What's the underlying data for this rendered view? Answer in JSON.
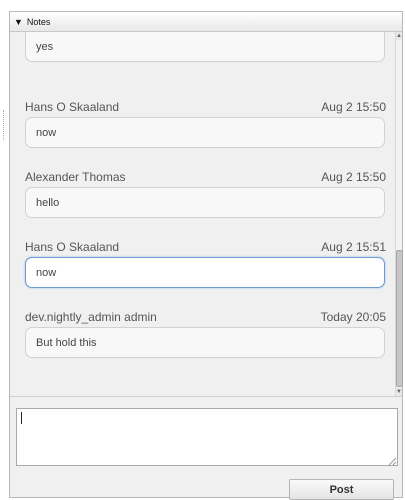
{
  "panel": {
    "title": "Notes",
    "collapse_icon": "triangle-down-icon"
  },
  "notes": [
    {
      "author": "",
      "time": "",
      "text": "yes"
    },
    {
      "author": "Hans O Skaaland",
      "time": "Aug 2 15:50",
      "text": "now"
    },
    {
      "author": "Alexander Thomas",
      "time": "Aug 2 15:50",
      "text": "hello"
    },
    {
      "author": "Hans O Skaaland",
      "time": "Aug 2 15:51",
      "text": "now"
    },
    {
      "author": "dev.nightly_admin admin",
      "time": "Today 20:05",
      "text": "But hold this"
    }
  ],
  "compose": {
    "value": "",
    "placeholder": ""
  },
  "post_button": {
    "label": "Post"
  },
  "colors": {
    "focus_border": "#6f9bd2",
    "panel_bg": "#f0f0f0"
  }
}
